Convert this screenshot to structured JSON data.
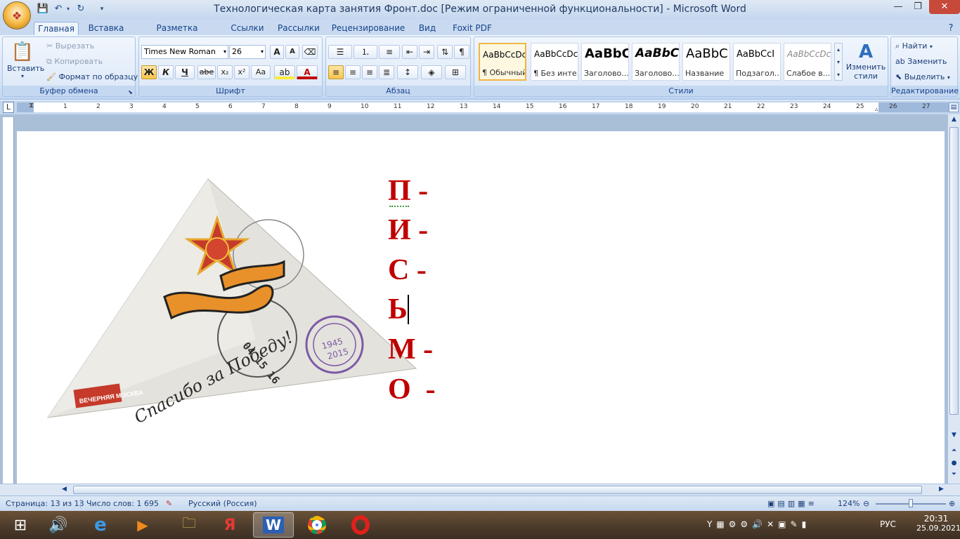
{
  "window": {
    "title": "Технологическая карта занятия Фронт.doc [Режим ограниченной функциональности] - Microsoft Word"
  },
  "tabs": [
    "Главная",
    "Вставка",
    "Разметка страницы",
    "Ссылки",
    "Рассылки",
    "Рецензирование",
    "Вид",
    "Foxit PDF"
  ],
  "ribbon": {
    "clipboard": {
      "label": "Буфер обмена",
      "paste": "Вставить",
      "cut": "Вырезать",
      "copy": "Копировать",
      "format_painter": "Формат по образцу"
    },
    "font": {
      "label": "Шрифт",
      "font_name": "Times New Roman",
      "font_size": "26",
      "bold": "Ж",
      "italic": "К",
      "underline": "Ч",
      "strike": "abe",
      "sub": "x₂",
      "sup": "x²",
      "case": "Aa"
    },
    "paragraph": {
      "label": "Абзац"
    },
    "styles": {
      "label": "Стили",
      "items": [
        {
          "sample": "AaBbCcDc",
          "name": "¶ Обычный"
        },
        {
          "sample": "AaBbCcDc",
          "name": "¶ Без инте..."
        },
        {
          "sample": "AaBbC",
          "name": "Заголово..."
        },
        {
          "sample": "AaBbCc",
          "name": "Заголово..."
        },
        {
          "sample": "AaBbC",
          "name": "Название"
        },
        {
          "sample": "AaBbCcI",
          "name": "Подзагол..."
        },
        {
          "sample": "AaBbCcDc",
          "name": "Слабое в..."
        }
      ],
      "change_styles": "Изменить стили"
    },
    "editing": {
      "label": "Редактирование",
      "find": "Найти",
      "replace": "Заменить",
      "select": "Выделить"
    }
  },
  "ruler": {
    "numbers": [
      "1",
      "2",
      "3",
      "4",
      "5",
      "6",
      "7",
      "8",
      "9",
      "10",
      "11",
      "12",
      "13",
      "14",
      "15",
      "16",
      "17",
      "18",
      "19",
      "20",
      "21",
      "22",
      "23",
      "24",
      "25",
      "26",
      "27"
    ]
  },
  "document": {
    "letters": [
      "П -",
      "И -",
      "С -",
      "Ь",
      "М -",
      "О  -"
    ],
    "image": {
      "stamp_year_top": "1945",
      "stamp_year_bottom": "2015",
      "script_text": "Спасибо за Победу!",
      "publisher": "ВЕЧЕРНЯЯ МОСКВА",
      "postmark": "04 15 16"
    }
  },
  "status": {
    "page": "Страница: 13 из 13",
    "words": "Число слов: 1 695",
    "language": "Русский (Россия)",
    "zoom": "124%"
  },
  "taskbar": {
    "lang": "РУС",
    "time": "20:31",
    "date": "25.09.2021"
  }
}
